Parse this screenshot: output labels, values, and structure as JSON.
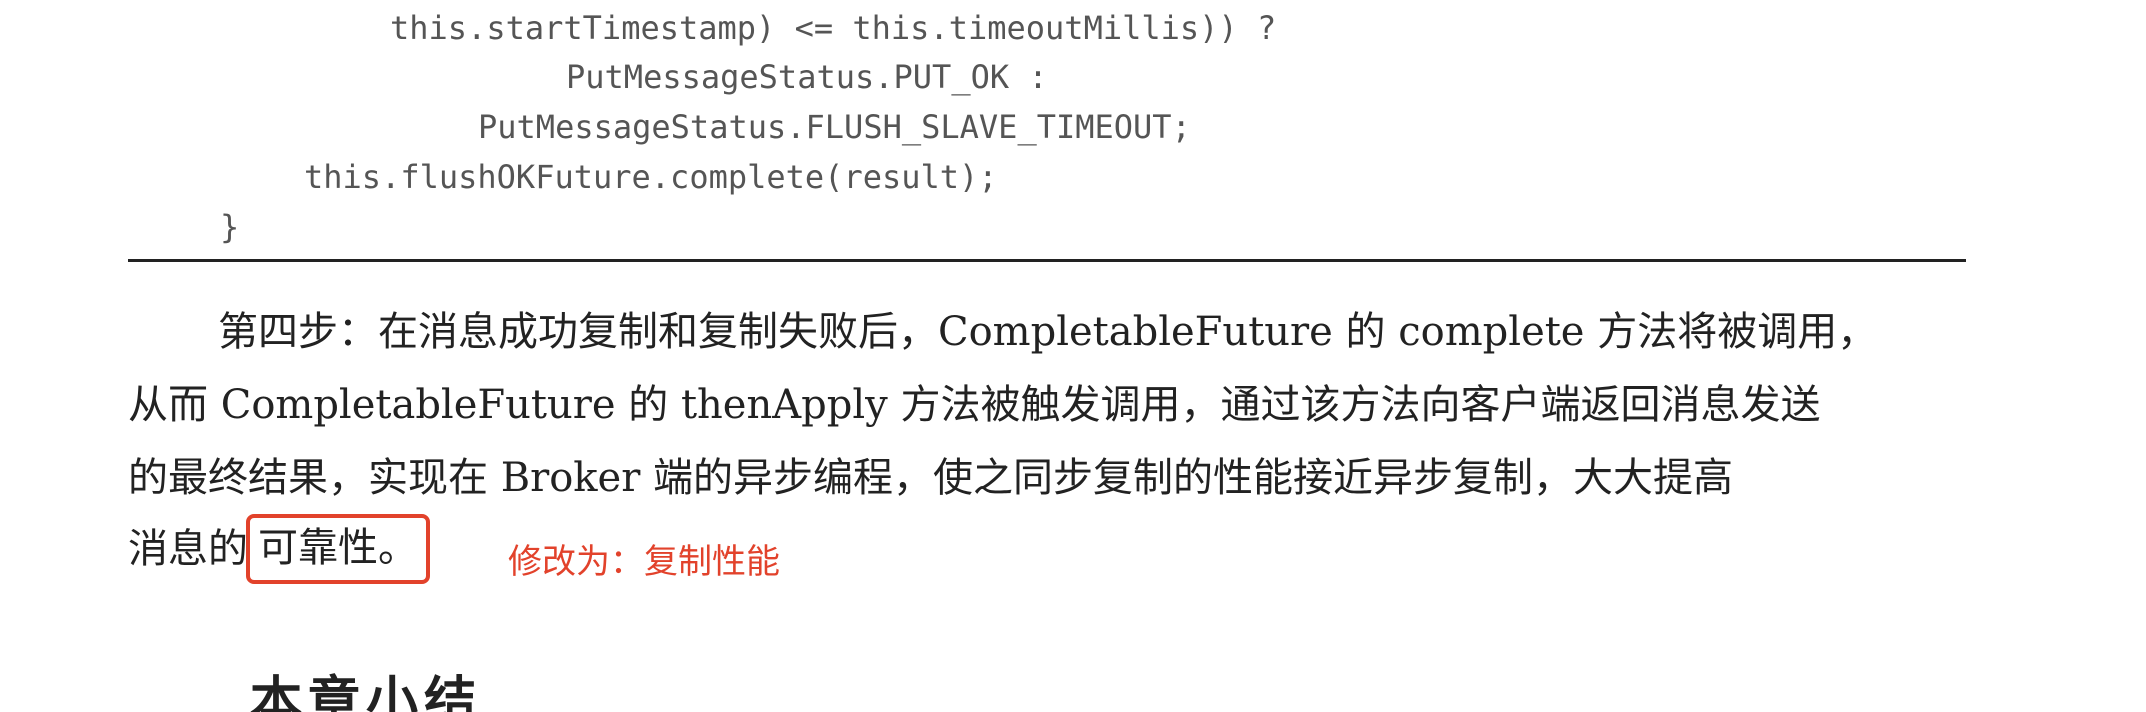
{
  "code": {
    "lines": [
      "this.startTimestamp) <= this.timeoutMillis)) ?",
      "PutMessageStatus.PUT_OK :",
      "PutMessageStatus.FLUSH_SLAVE_TIMEOUT;",
      "this.flushOKFuture.complete(result);",
      "}"
    ]
  },
  "paragraph": {
    "line1": "第四步：在消息成功复制和复制失败后，CompletableFuture 的 complete 方法将被调用，",
    "line2": "从而 CompletableFuture 的 thenApply 方法被触发调用，通过该方法向客户端返回消息发送",
    "line3": "的最终结果，实现在 Broker 端的异步编程，使之同步复制的性能接近异步复制，大大提高",
    "line4_prefix": "消息的",
    "line4_highlight": "可靠性。"
  },
  "annotation": {
    "text": "修改为：复制性能",
    "color": "#e2422b"
  },
  "heading_cut": {
    "text": "本章小结"
  }
}
